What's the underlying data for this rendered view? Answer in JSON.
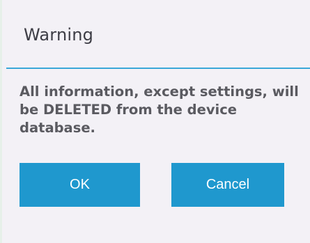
{
  "dialog": {
    "title": "Warning",
    "message": "All information, except settings, will be DELETED from the device database.",
    "ok_label": "OK",
    "cancel_label": "Cancel"
  },
  "colors": {
    "background": "#f3f1f6",
    "accent": "#39a8d8",
    "button": "#1f98ce",
    "button_text": "#ffffff",
    "title_text": "#3d3d45",
    "message_text": "#5a5a60"
  }
}
